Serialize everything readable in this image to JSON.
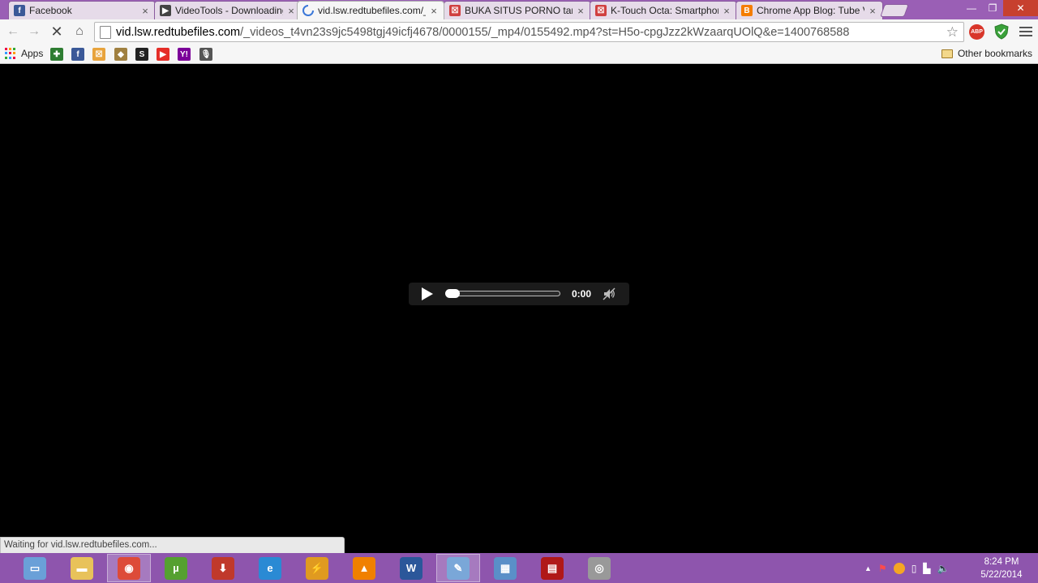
{
  "tabs": [
    {
      "title": "Facebook",
      "icon": "facebook-icon",
      "color": "#3b5998",
      "glyph": "f"
    },
    {
      "title": "VideoTools - Downloading",
      "icon": "videotools-icon",
      "color": "#444444",
      "glyph": "▶"
    },
    {
      "title": "vid.lsw.redtubefiles.com/_",
      "icon": "loading-spinner-icon",
      "color": "#ffffff",
      "glyph": "",
      "active": true
    },
    {
      "title": "BUKA SITUS PORNO tanpa",
      "icon": "page-icon",
      "color": "#d04040",
      "glyph": "☒"
    },
    {
      "title": "K-Touch Octa: Smartphone",
      "icon": "page-icon",
      "color": "#d04040",
      "glyph": "☒"
    },
    {
      "title": "Chrome App Blog: Tube V",
      "icon": "blogger-icon",
      "color": "#f57d00",
      "glyph": "B"
    }
  ],
  "window": {
    "minimize": "—",
    "maximize": "❐",
    "close": "✕"
  },
  "toolbar": {
    "url_host": "vid.lsw.redtubefiles.com",
    "url_path": "/_videos_t4vn23s9jc5498tgj49icfj4678/0000155/_mp4/0155492.mp4?st=H5o-cpgJzz2kWzaarqUOlQ&e=1400768588",
    "back": "←",
    "forward": "→",
    "stop": "✕",
    "home": "⌂",
    "star": "☆",
    "abp": "ABP"
  },
  "bookmarks": {
    "apps_label": "Apps",
    "items": [
      {
        "name": "bookmark-1-icon",
        "color": "#2e7d32",
        "glyph": "✚"
      },
      {
        "name": "facebook-icon",
        "color": "#3b5998",
        "glyph": "f"
      },
      {
        "name": "page-icon",
        "color": "#e8a33c",
        "glyph": "☒"
      },
      {
        "name": "shield-icon",
        "color": "#a08040",
        "glyph": "◆"
      },
      {
        "name": "bookmark-5-icon",
        "color": "#222222",
        "glyph": "S"
      },
      {
        "name": "youtube-icon",
        "color": "#e52d27",
        "glyph": "▶"
      },
      {
        "name": "yahoo-icon",
        "color": "#7b0099",
        "glyph": "Y!"
      },
      {
        "name": "microphone-icon",
        "color": "#555555",
        "glyph": "🎙"
      }
    ],
    "other_label": "Other bookmarks"
  },
  "player": {
    "time": "0:00",
    "progress": 0
  },
  "status": "Waiting for vid.lsw.redtubefiles.com...",
  "taskbar": [
    {
      "name": "file-explorer-icon",
      "color": "#6aa0d8",
      "glyph": "▭"
    },
    {
      "name": "folder-icon",
      "color": "#e8c25a",
      "glyph": "▬"
    },
    {
      "name": "chrome-icon",
      "color": "#dd4b39",
      "glyph": "◉",
      "running": true
    },
    {
      "name": "utorrent-icon",
      "color": "#55a030",
      "glyph": "µ"
    },
    {
      "name": "download-manager-icon",
      "color": "#c0392b",
      "glyph": "⬇"
    },
    {
      "name": "internet-explorer-icon",
      "color": "#2a8ad4",
      "glyph": "e"
    },
    {
      "name": "winamp-icon",
      "color": "#e09a20",
      "glyph": "⚡"
    },
    {
      "name": "vlc-icon",
      "color": "#f08000",
      "glyph": "▲"
    },
    {
      "name": "word-icon",
      "color": "#2b579a",
      "glyph": "W"
    },
    {
      "name": "paint-icon",
      "color": "#7aa7d8",
      "glyph": "✎",
      "running": true
    },
    {
      "name": "calculator-icon",
      "color": "#5a8fc8",
      "glyph": "▦"
    },
    {
      "name": "app-icon",
      "color": "#b01818",
      "glyph": "▤"
    },
    {
      "name": "disk-icon",
      "color": "#999999",
      "glyph": "◎"
    }
  ],
  "tray": {
    "chevron": "▲",
    "time": "8:24 PM",
    "date": "5/22/2014"
  }
}
